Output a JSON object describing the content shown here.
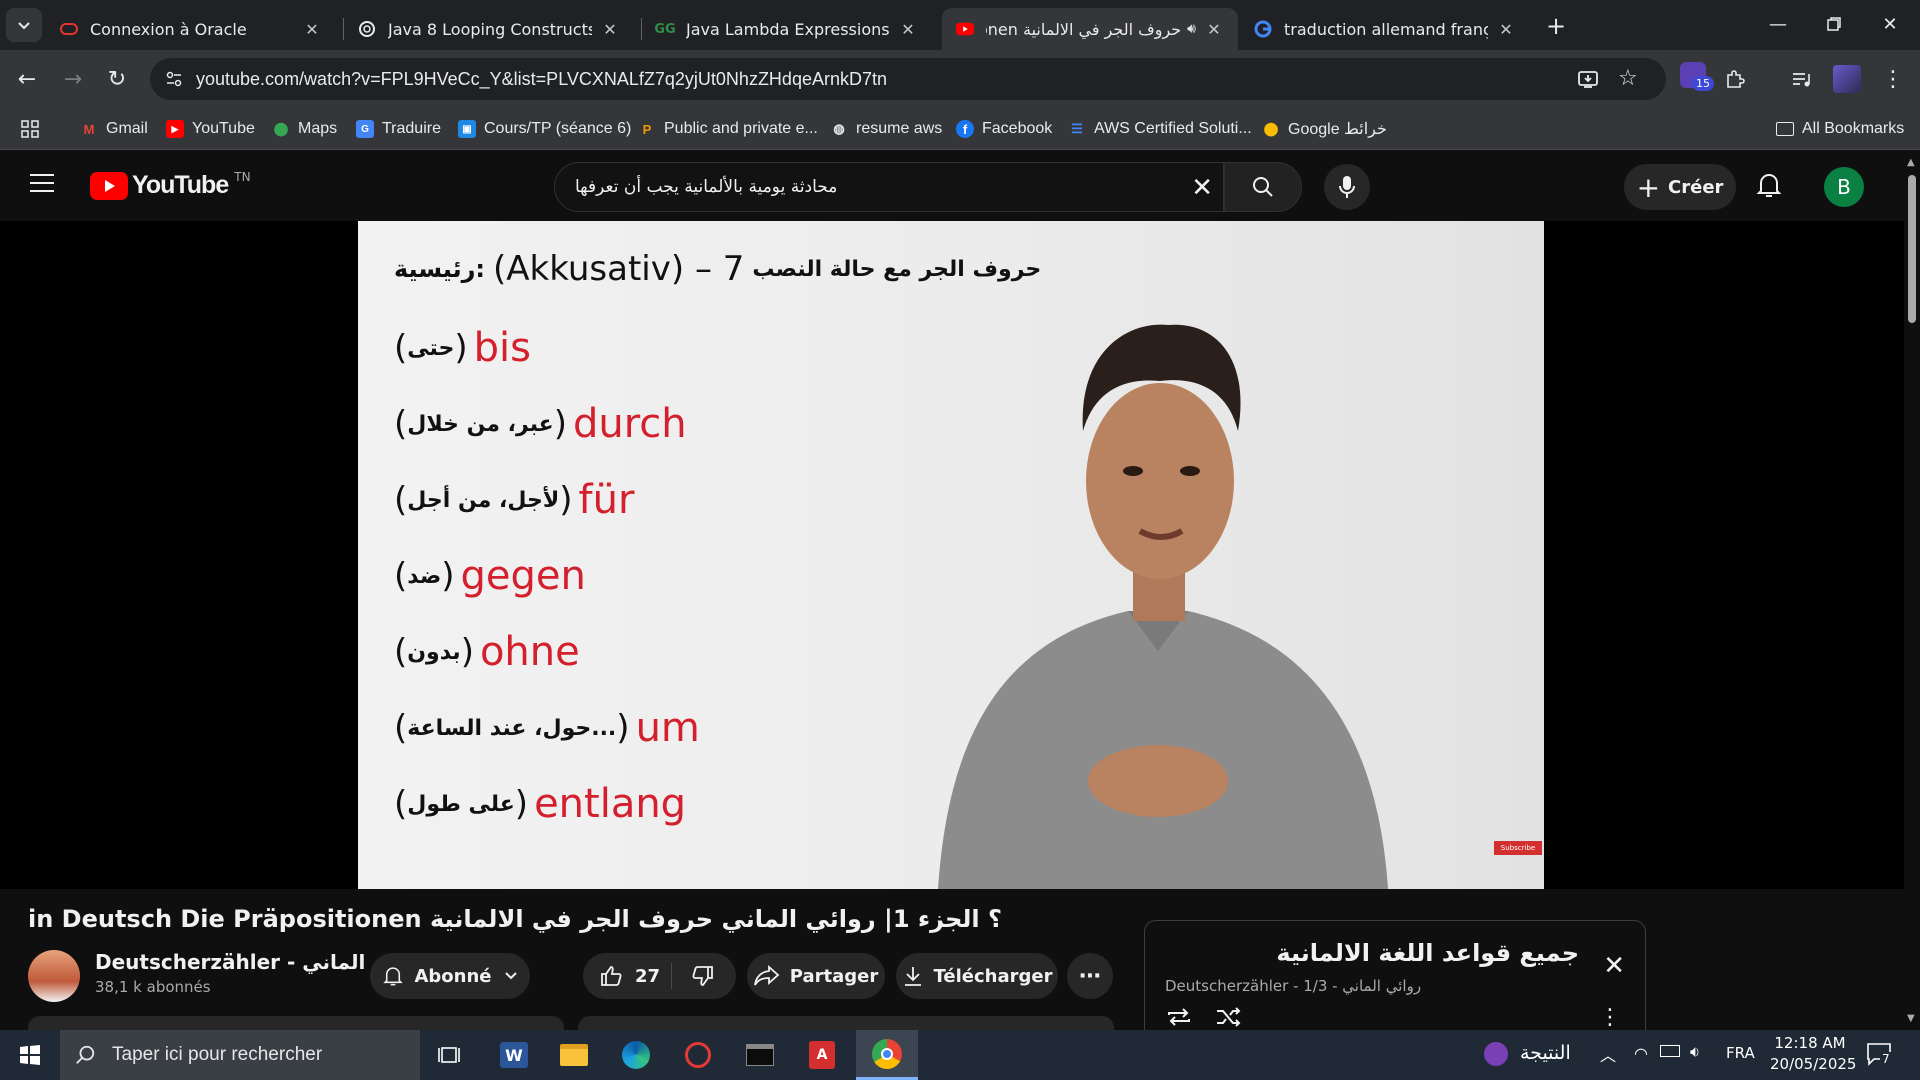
{
  "browser": {
    "tabs": [
      {
        "title": "Connexion à Oracle",
        "icon": "oracle-icon"
      },
      {
        "title": "Java 8 Looping Constructs",
        "icon": "openai-icon"
      },
      {
        "title": "Java Lambda Expressions | Geek",
        "icon": "gfg-icon"
      },
      {
        "title": "حروف الجر في الالمانية onen",
        "icon": "youtube-icon",
        "active": true
      },
      {
        "title": "traduction allemand français - G",
        "icon": "google-icon"
      }
    ],
    "url": "youtube.com/watch?v=FPL9HVeCc_Y&list=PLVCXNALfZ7q2yjUt0NhzZHdqeArnkD7tn",
    "extension_badge": "15",
    "bookmarks": [
      {
        "label": "Gmail",
        "icon": "gmail-icon"
      },
      {
        "label": "YouTube",
        "icon": "youtube-icon"
      },
      {
        "label": "Maps",
        "icon": "maps-icon"
      },
      {
        "label": "Traduire",
        "icon": "translate-icon"
      },
      {
        "label": "Cours/TP (séance 6)",
        "icon": "classroom-icon"
      },
      {
        "label": "Public and private e...",
        "icon": "p-icon"
      },
      {
        "label": "resume aws",
        "icon": "globe-icon"
      },
      {
        "label": "Facebook",
        "icon": "facebook-icon"
      },
      {
        "label": "AWS Certified Soluti...",
        "icon": "list-icon"
      },
      {
        "label": "Google خرائط",
        "icon": "maps-icon"
      }
    ],
    "all_bookmarks": "All Bookmarks"
  },
  "youtube": {
    "logo_text": "YouTube",
    "country": "TN",
    "search_query": "محادثة يومية بالألمانية يجب أن تعرفها",
    "create_label": "Créer",
    "avatar_letter": "B",
    "accent": "#ff0000"
  },
  "video_frame": {
    "headline_ar": "حروف الجر مع حالة النصب",
    "headline_mid": "(Akkusativ) – 7",
    "headline_ar2": "رئيسية:",
    "lines": [
      {
        "de": "bis",
        "ar": "حتى"
      },
      {
        "de": "durch",
        "ar": "عبر، من خلال"
      },
      {
        "de": "für",
        "ar": "لأجل، من أجل"
      },
      {
        "de": "gegen",
        "ar": "ضد"
      },
      {
        "de": "ohne",
        "ar": "بدون"
      },
      {
        "de": "um",
        "ar": "حول، عند الساعة..."
      },
      {
        "de": "entlang",
        "ar": "على طول"
      }
    ],
    "subscribe_watermark": "Subscribe"
  },
  "video": {
    "title": "؟ الجزء 1| روائي الماني حروف الجر في الالمانية in Deutsch Die Präpositionen",
    "channel": "Deutscherzähler - روائي الماني",
    "subscribers": "38,1 k abonnés",
    "subscribed_label": "Abonné",
    "likes": "27",
    "share_label": "Partager",
    "download_label": "Télécharger"
  },
  "playlist": {
    "title": "جميع قواعد اللغة الالمانية",
    "meta": "Deutscherzähler - روائي الماني - 1/3"
  },
  "taskbar": {
    "search_placeholder": "Taper ici pour rechercher",
    "weather": "النتيجة",
    "language": "FRA",
    "time": "12:18 AM",
    "date": "20/05/2025",
    "notification_count": "7"
  }
}
